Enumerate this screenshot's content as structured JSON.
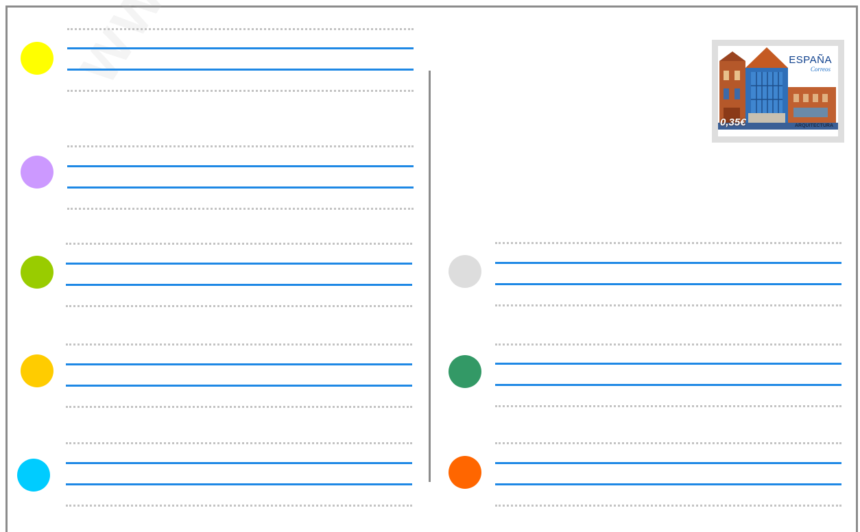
{
  "watermark": {
    "text": "www.yo"
  },
  "stamp": {
    "country": "ESPAÑA",
    "postal_service": "Correos",
    "value": "0,35€",
    "theme": "ARQUITECTURA"
  },
  "colors": {
    "border": "#8c8c8c",
    "writing_line": "#1e88e5",
    "dotted_line": "#c3c3c3"
  },
  "address_blocks_left": [
    {
      "dot_color": "#ffff00"
    },
    {
      "dot_color": "#cc99ff"
    },
    {
      "dot_color": "#99cc00"
    },
    {
      "dot_color": "#ffcc00"
    },
    {
      "dot_color": "#00ccff"
    }
  ],
  "address_blocks_right": [
    {
      "dot_color": "#dddddd"
    },
    {
      "dot_color": "#339966"
    },
    {
      "dot_color": "#ff6600"
    }
  ]
}
